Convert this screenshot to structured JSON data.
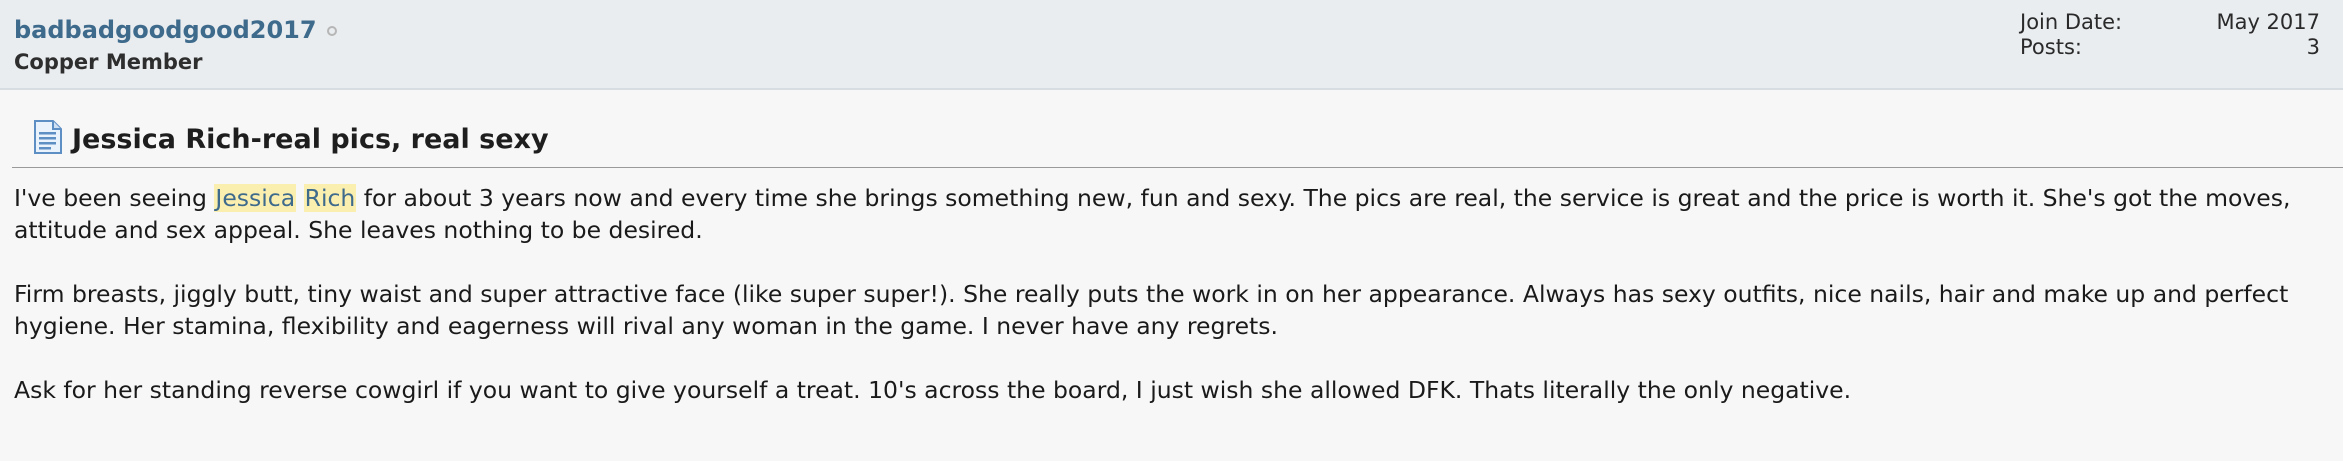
{
  "user": {
    "username": "badbadgoodgood2017",
    "status_icon": "offline-icon",
    "title": "Copper Member",
    "stats": [
      {
        "label": "Join Date:",
        "value": "May 2017"
      },
      {
        "label": "Posts:",
        "value": "3"
      }
    ]
  },
  "post": {
    "title_icon": "document-icon",
    "title": "Jessica Rich-real pics, real sexy",
    "p1": {
      "before": "I've been seeing ",
      "highlight_1": "Jessica",
      "between": " ",
      "highlight_2": "Rich",
      "after": " for about 3 years now and every time she brings something new, fun and sexy. The pics are real, the service is great and the price is worth it. She's got the moves, attitude and sex appeal. She leaves nothing to be desired."
    },
    "p2": "Firm breasts, jiggly butt, tiny waist and super attractive face (like super super!). She really puts the work in on her appearance. Always has sexy outfits, nice nails, hair and make up and perfect hygiene. Her stamina, flexibility and eagerness will rival any woman in the game. I never have any regrets.",
    "p3": "Ask for her standing reverse cowgirl if you want to give yourself a treat. 10's across the board, I just wish she allowed DFK. Thats literally the only negative."
  },
  "colors": {
    "username": "#3e6a8c",
    "header_bg": "#e9edf0",
    "highlight_bg": "#fbefb0"
  }
}
